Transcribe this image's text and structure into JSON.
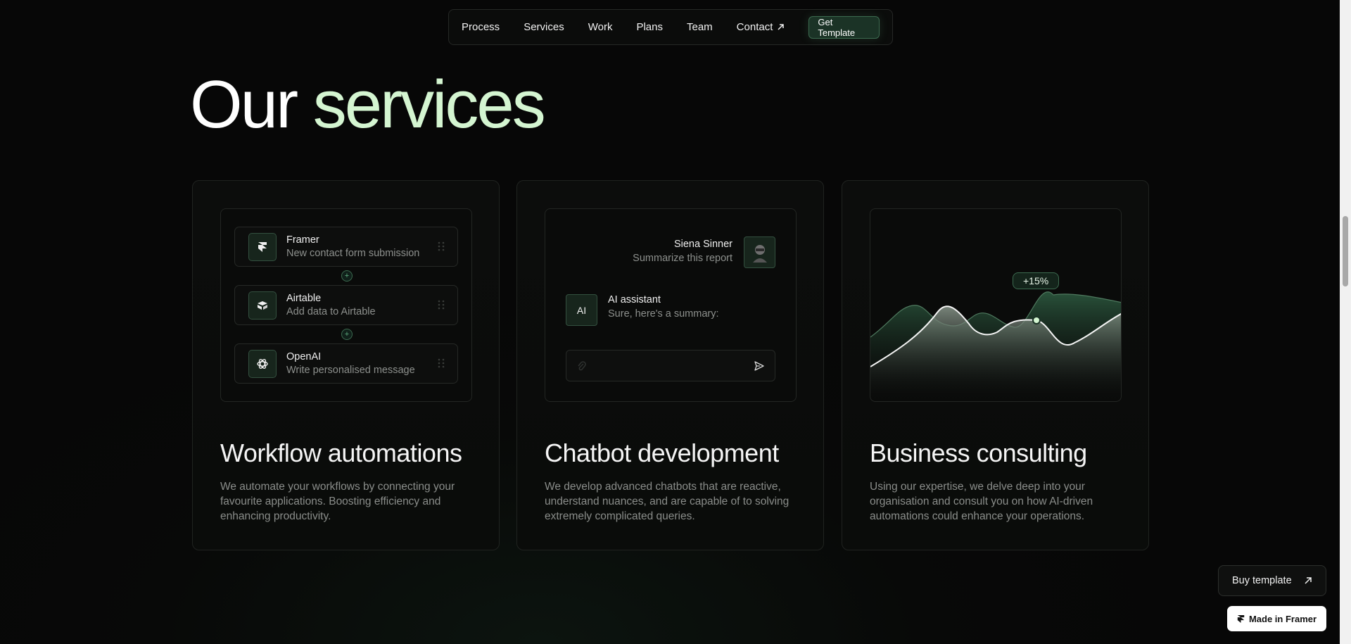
{
  "nav": {
    "items": [
      "Process",
      "Services",
      "Work",
      "Plans",
      "Team",
      "Contact"
    ],
    "cta": "Get Template"
  },
  "hero": {
    "title_plain": "Our",
    "title_accent": "services"
  },
  "cards": [
    {
      "title": "Workflow automations",
      "description": "We automate your workflows by connecting your favourite applications. Boosting efficiency and enhancing productivity.",
      "steps": [
        {
          "title": "Framer",
          "subtitle": "New contact form submission",
          "icon": "framer-icon"
        },
        {
          "title": "Airtable",
          "subtitle": "Add data to Airtable",
          "icon": "airtable-icon"
        },
        {
          "title": "OpenAI",
          "subtitle": "Write personalised message",
          "icon": "openai-icon"
        }
      ],
      "connector": "+"
    },
    {
      "title": "Chatbot development",
      "description": "We develop advanced chatbots that are reactive, understand nuances, and are capable of to solving extremely complicated queries.",
      "user_name": "Siena Sinner",
      "user_message": "Summarize this report",
      "ai_badge": "AI",
      "ai_name": "AI assistant",
      "ai_message": "Sure, here's a summary:",
      "input_value": ""
    },
    {
      "title": "Business consulting",
      "description": "Using our expertise, we delve deep into your organisation and consult you on how AI-driven automations could enhance your operations.",
      "badge": "+15%"
    }
  ],
  "floating": {
    "buy": "Buy template",
    "framer": "Made in Framer"
  },
  "colors": {
    "accent": "#d4f5d1",
    "green": "#3c6a4f",
    "background": "#080908"
  }
}
